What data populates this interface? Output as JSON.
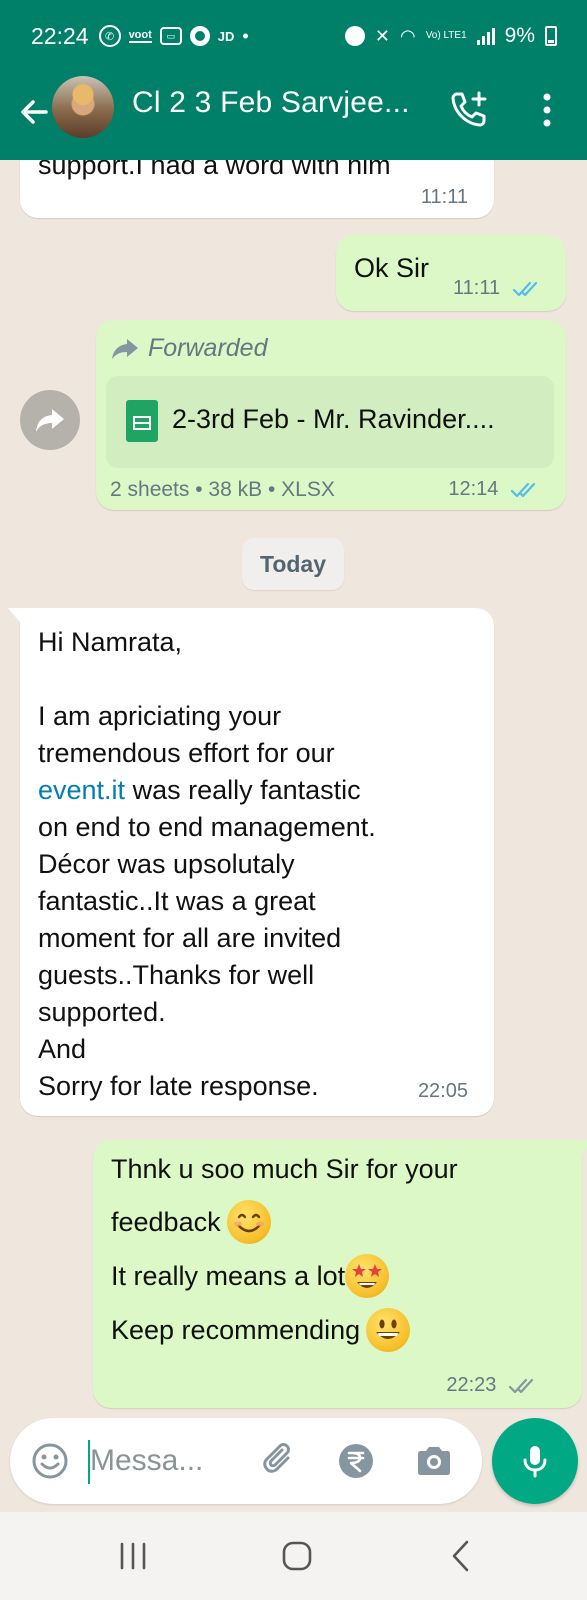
{
  "status_bar": {
    "time": "22:24",
    "icons": [
      "whatsapp-icon",
      "voot-icon",
      "gallery-icon",
      "chrome-icon",
      "jd-icon",
      "dot-icon",
      "alarm-icon",
      "mute-icon",
      "wifi-icon",
      "lte-icon",
      "signal-icon",
      "battery-icon"
    ],
    "voot_label": "voot",
    "jd_label": "JD",
    "lte_label": "Vo) LTE1",
    "battery": "9%"
  },
  "header": {
    "title": "Cl 2 3 Feb Sarvjee...",
    "icons": [
      "back-arrow-icon",
      "avatar",
      "add-call-icon",
      "more-vert-icon"
    ]
  },
  "messages": [
    {
      "direction": "incoming",
      "text": "support.I had a word with him",
      "time": "11:11"
    },
    {
      "direction": "outgoing",
      "text": "Ok Sir",
      "time": "11:11",
      "status": "read"
    },
    {
      "direction": "outgoing",
      "type": "document",
      "forwarded_label": "Forwarded",
      "file_name": "2-3rd Feb - Mr. Ravinder....",
      "file_meta": "2 sheets • 38 kB • XLSX",
      "time": "12:14",
      "status": "read"
    },
    {
      "type": "date_separator",
      "text": "Today"
    },
    {
      "direction": "incoming",
      "lines": [
        "Hi Namrata,",
        "",
        "I am apriciating your",
        "tremendous effort for our",
        "event.it",
        " was really fantastic",
        "on end to end management.",
        "Décor was upsolutaly",
        "fantastic..It was a great",
        "moment for all are invited",
        "guests..Thanks for well",
        "supported.",
        "And",
        "Sorry for late response."
      ],
      "time": "22:05"
    },
    {
      "direction": "outgoing",
      "lines": [
        "Thnk u soo much Sir for your",
        "feedback",
        "It really means a lot",
        "Keep recommending"
      ],
      "emojis": [
        "smiling-face-emoji",
        "star-struck-emoji",
        "grinning-face-emoji"
      ],
      "time": "22:23",
      "status": "delivered"
    }
  ],
  "composer": {
    "placeholder": "Messa...",
    "icons": [
      "emoji-icon",
      "attach-icon",
      "rupee-icon",
      "camera-icon",
      "mic-icon"
    ]
  },
  "nav_bar": {
    "icons": [
      "recents-icon",
      "home-icon",
      "back-icon"
    ]
  },
  "colors": {
    "header": "#008069",
    "incoming_bubble": "#ffffff",
    "outgoing_bubble": "#dcf8c6",
    "chat_bg": "#efe7dd",
    "read_ticks": "#53bdeb",
    "delivered_ticks": "#8696a0",
    "link": "#027eb5",
    "mic_button": "#00a884"
  }
}
